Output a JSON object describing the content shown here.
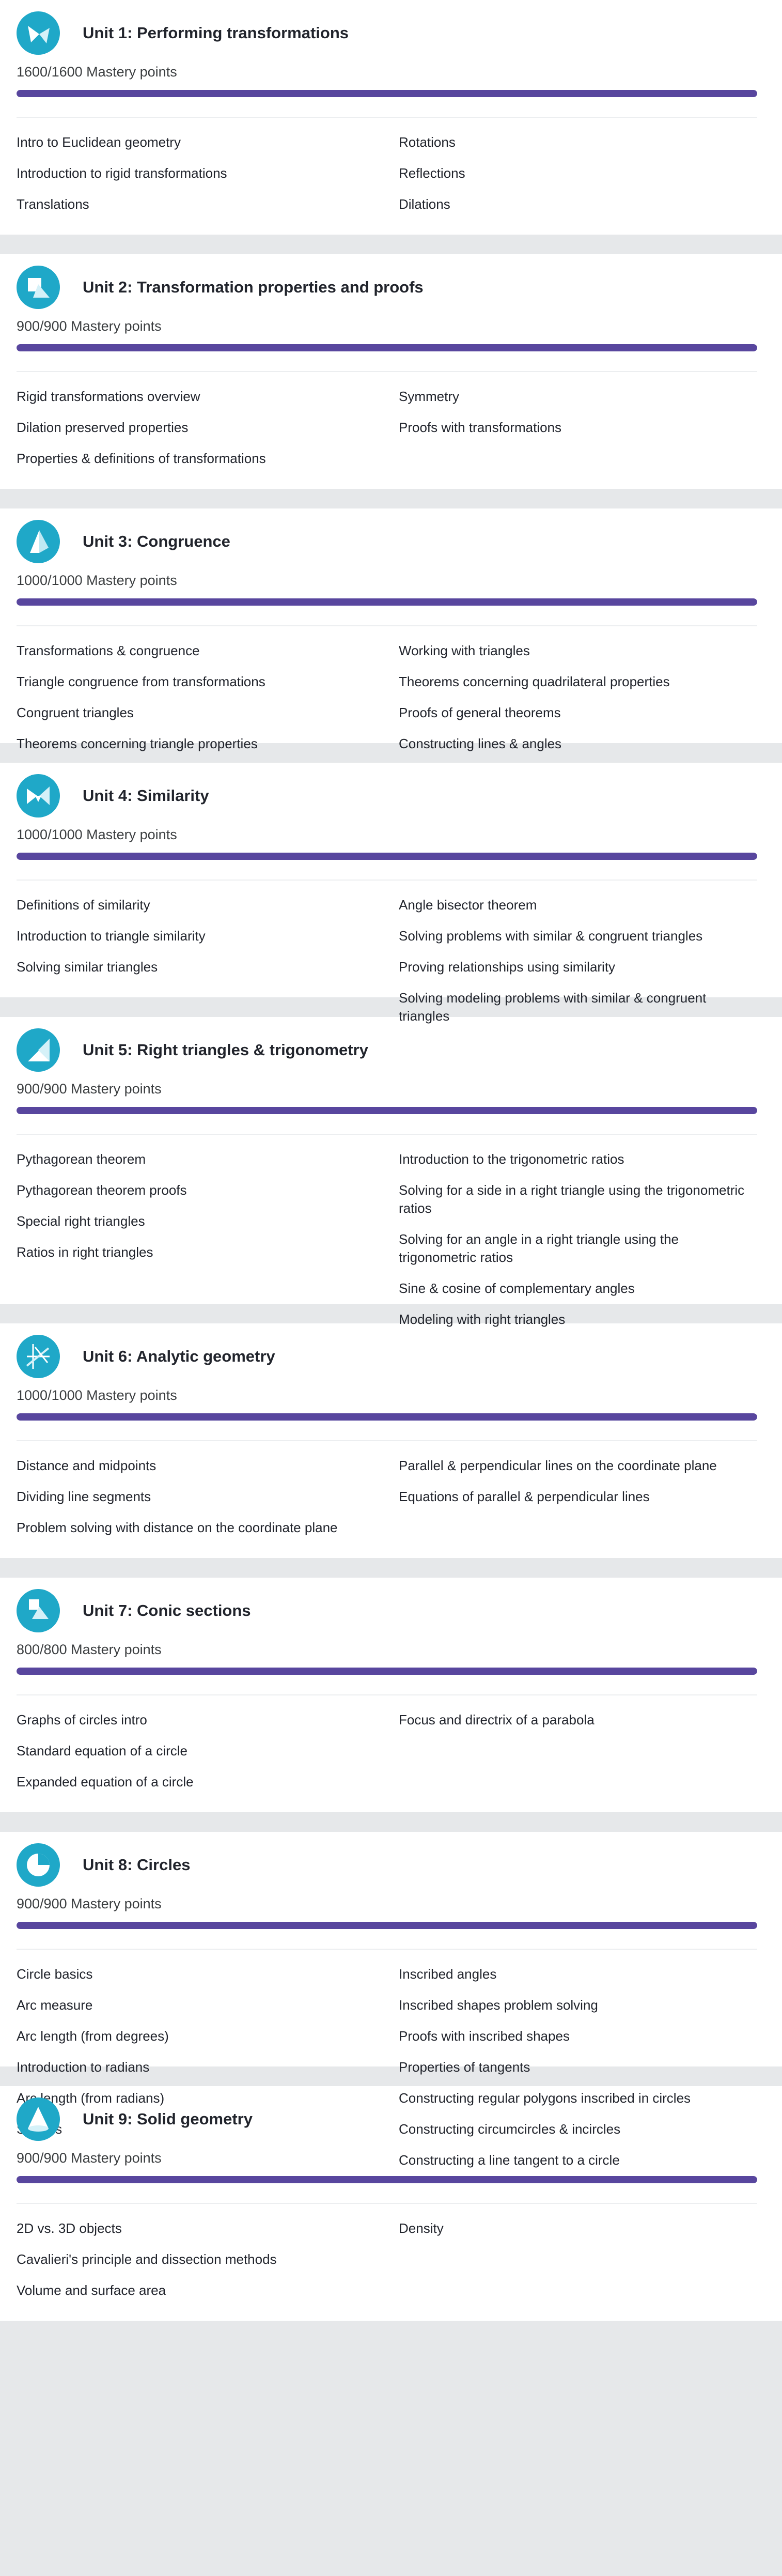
{
  "units": [
    {
      "title": "Unit 1: Performing transformations",
      "mastery": "1600/1600 Mastery points",
      "progress": 1.0,
      "icon": "transformations-icon",
      "left": [
        "Intro to Euclidean geometry",
        "Introduction to rigid transformations",
        "Translations"
      ],
      "right": [
        "Rotations",
        "Reflections",
        "Dilations"
      ]
    },
    {
      "title": "Unit 2: Transformation properties and proofs",
      "mastery": "900/900 Mastery points",
      "progress": 1.0,
      "icon": "proofs-icon",
      "left": [
        "Rigid transformations overview",
        "Dilation preserved properties",
        "Properties & definitions of transformations"
      ],
      "right": [
        "Symmetry",
        "Proofs with transformations"
      ]
    },
    {
      "title": "Unit 3: Congruence",
      "mastery": "1000/1000 Mastery points",
      "progress": 1.0,
      "icon": "congruence-icon",
      "left": [
        "Transformations & congruence",
        "Triangle congruence from transformations",
        "Congruent triangles",
        "Theorems concerning triangle properties"
      ],
      "right": [
        "Working with triangles",
        "Theorems concerning quadrilateral properties",
        "Proofs of general theorems",
        "Constructing lines & angles"
      ]
    },
    {
      "title": "Unit 4: Similarity",
      "mastery": "1000/1000 Mastery points",
      "progress": 1.0,
      "icon": "similarity-icon",
      "left": [
        "Definitions of similarity",
        "Introduction to triangle similarity",
        "Solving similar triangles"
      ],
      "right": [
        "Angle bisector theorem",
        "Solving problems with similar & congruent triangles",
        "Proving relationships using similarity",
        "Solving modeling problems with similar & congruent triangles"
      ]
    },
    {
      "title": "Unit 5: Right triangles & trigonometry",
      "mastery": "900/900 Mastery points",
      "progress": 1.0,
      "icon": "trigonometry-icon",
      "left": [
        "Pythagorean theorem",
        "Pythagorean theorem proofs",
        "Special right triangles",
        "Ratios in right triangles"
      ],
      "right": [
        "Introduction to the trigonometric ratios",
        "Solving for a side in a right triangle using the trigonometric ratios",
        "Solving for an angle in a right triangle using the trigonometric ratios",
        "Sine & cosine of complementary angles",
        "Modeling with right triangles"
      ]
    },
    {
      "title": "Unit 6: Analytic geometry",
      "mastery": "1000/1000 Mastery points",
      "progress": 1.0,
      "icon": "analytic-geometry-icon",
      "left": [
        "Distance and midpoints",
        "Dividing line segments",
        "Problem solving with distance on the coordinate plane"
      ],
      "right": [
        "Parallel & perpendicular lines on the coordinate plane",
        "Equations of parallel & perpendicular lines"
      ]
    },
    {
      "title": "Unit 7: Conic sections",
      "mastery": "800/800 Mastery points",
      "progress": 1.0,
      "icon": "conic-sections-icon",
      "left": [
        "Graphs of circles intro",
        "Standard equation of a circle",
        "Expanded equation of a circle"
      ],
      "right": [
        "Focus and directrix of a parabola"
      ]
    },
    {
      "title": "Unit 8: Circles",
      "mastery": "900/900 Mastery points",
      "progress": 1.0,
      "icon": "circles-icon",
      "left": [
        "Circle basics",
        "Arc measure",
        "Arc length (from degrees)",
        "Introduction to radians",
        "Arc length (from radians)",
        "Sectors"
      ],
      "right": [
        "Inscribed angles",
        "Inscribed shapes problem solving",
        "Proofs with inscribed shapes",
        "Properties of tangents",
        "Constructing regular polygons inscribed in circles",
        "Constructing circumcircles & incircles",
        "Constructing a line tangent to a circle"
      ]
    },
    {
      "title": "Unit 9: Solid geometry",
      "mastery": "900/900 Mastery points",
      "progress": 1.0,
      "icon": "solid-geometry-icon",
      "left": [
        "2D vs. 3D objects",
        "Cavalieri's principle and dissection methods",
        "Volume and surface area"
      ],
      "right": [
        "Density"
      ]
    }
  ],
  "colors": {
    "progress": "#58469e",
    "icon_bg": "#1fa8c8",
    "page_bg": "#e6e8ea",
    "card_bg": "#ffffff"
  }
}
